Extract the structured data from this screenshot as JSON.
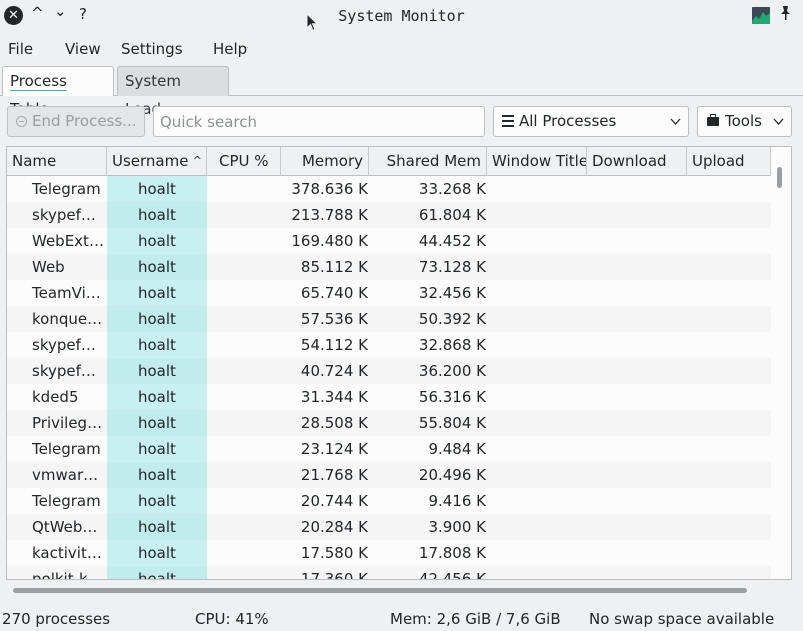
{
  "window": {
    "title": "System Monitor",
    "close_glyph": "✕",
    "minimize_glyph": "^",
    "maximize_glyph": "⌄",
    "help_glyph": "?",
    "pin_glyph": "📌"
  },
  "menu": {
    "file": "File",
    "view": "View",
    "settings": "Settings",
    "help": "Help"
  },
  "tabs": {
    "process_table": "Process Table",
    "system_load": "System Load"
  },
  "toolbar": {
    "end_process": "End Process...",
    "search_placeholder": "Quick search",
    "filter_selected": "All Processes",
    "tools": "Tools"
  },
  "table": {
    "columns": {
      "name": "Name",
      "username": "Username",
      "cpu": "CPU %",
      "memory": "Memory",
      "shared_mem": "Shared Mem",
      "window_title": "Window Title",
      "download": "Download",
      "upload": "Upload"
    },
    "sort_indicator": "^",
    "rows": [
      {
        "name": "Telegram",
        "user": "hoalt",
        "cpu": "",
        "mem": "378.636 K",
        "shm": "33.268 K"
      },
      {
        "name": "skypef…",
        "user": "hoalt",
        "cpu": "",
        "mem": "213.788 K",
        "shm": "61.804 K"
      },
      {
        "name": "WebExt…",
        "user": "hoalt",
        "cpu": "",
        "mem": "169.480 K",
        "shm": "44.452 K"
      },
      {
        "name": "Web",
        "user": "hoalt",
        "cpu": "",
        "mem": "85.112 K",
        "shm": "73.128 K"
      },
      {
        "name": "TeamVi…",
        "user": "hoalt",
        "cpu": "",
        "mem": "65.740 K",
        "shm": "32.456 K"
      },
      {
        "name": "konque…",
        "user": "hoalt",
        "cpu": "",
        "mem": "57.536 K",
        "shm": "50.392 K"
      },
      {
        "name": "skypef…",
        "user": "hoalt",
        "cpu": "",
        "mem": "54.112 K",
        "shm": "32.868 K"
      },
      {
        "name": "skypef…",
        "user": "hoalt",
        "cpu": "",
        "mem": "40.724 K",
        "shm": "36.200 K"
      },
      {
        "name": "kded5",
        "user": "hoalt",
        "cpu": "",
        "mem": "31.344 K",
        "shm": "56.316 K"
      },
      {
        "name": "Privileg…",
        "user": "hoalt",
        "cpu": "",
        "mem": "28.508 K",
        "shm": "55.804 K"
      },
      {
        "name": "Telegram",
        "user": "hoalt",
        "cpu": "",
        "mem": "23.124 K",
        "shm": "9.484 K"
      },
      {
        "name": "vmwar…",
        "user": "hoalt",
        "cpu": "",
        "mem": "21.768 K",
        "shm": "20.496 K"
      },
      {
        "name": "Telegram",
        "user": "hoalt",
        "cpu": "",
        "mem": "20.744 K",
        "shm": "9.416 K"
      },
      {
        "name": "QtWeb…",
        "user": "hoalt",
        "cpu": "",
        "mem": "20.284 K",
        "shm": "3.900 K"
      },
      {
        "name": "kactivit…",
        "user": "hoalt",
        "cpu": "",
        "mem": "17.580 K",
        "shm": "17.808 K"
      },
      {
        "name": "polkit-k…",
        "user": "hoalt",
        "cpu": "",
        "mem": "17.360 K",
        "shm": "42.456 K"
      }
    ]
  },
  "statusbar": {
    "processes": "270 processes",
    "cpu": "CPU: 41%",
    "mem": "Mem: 2,6 GiB / 7,6 GiB",
    "swap": "No swap space available"
  },
  "colors": {
    "username_highlight": "#c9f0f0",
    "accent": "#3daee9"
  }
}
